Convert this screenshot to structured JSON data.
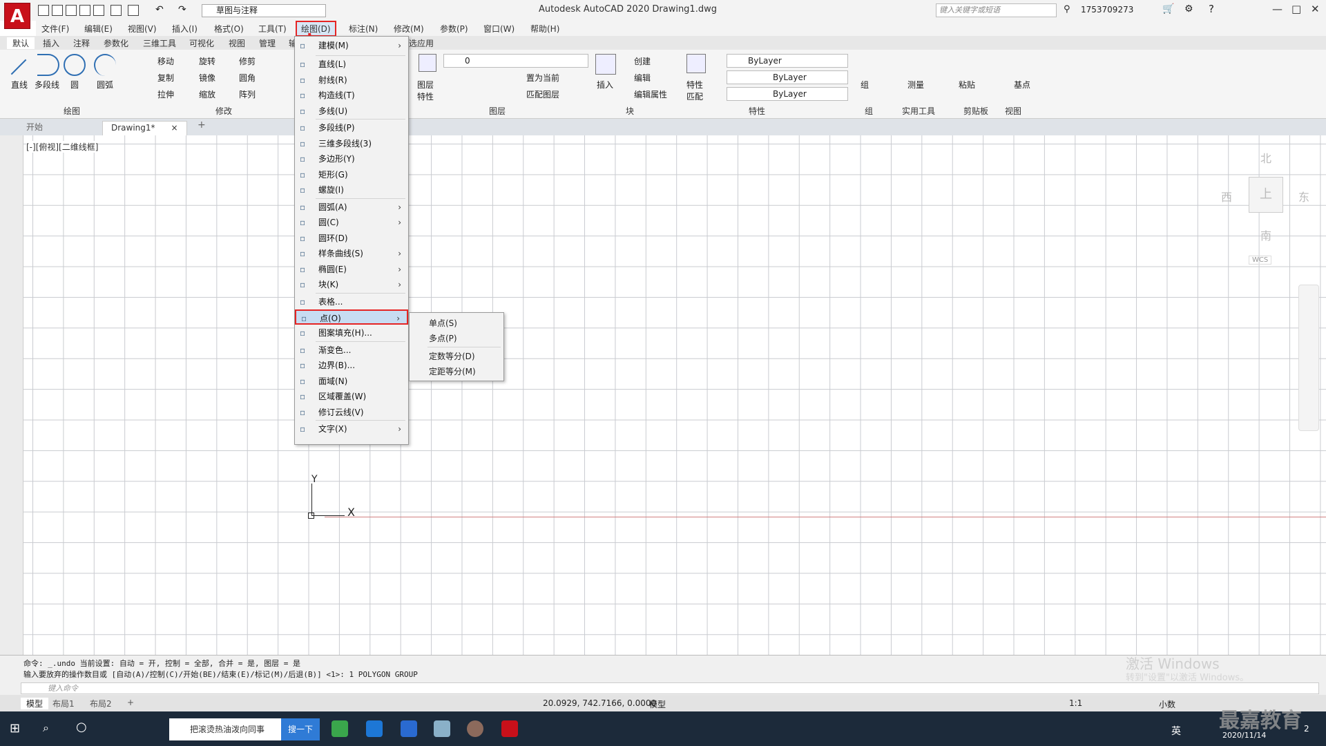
{
  "app": {
    "logo": "A",
    "workspace": "草图与注释",
    "window_title": "Autodesk AutoCAD 2020    Drawing1.dwg",
    "search_placeholder": "键入关键字或短语",
    "user": "1753709273"
  },
  "menubar": [
    "文件(F)",
    "编辑(E)",
    "视图(V)",
    "插入(I)",
    "格式(O)",
    "工具(T)",
    "绘图(D)",
    "标注(N)",
    "修改(M)",
    "参数(P)",
    "窗口(W)",
    "帮助(H)"
  ],
  "ribbon_tabs": [
    "默认",
    "插入",
    "注释",
    "参数化",
    "三维工具",
    "可视化",
    "视图",
    "管理",
    "输",
    "选应用"
  ],
  "ribbon": {
    "draw": {
      "title": "绘图",
      "items": [
        "直线",
        "多段线",
        "圆",
        "圆弧"
      ]
    },
    "modify": {
      "title": "修改",
      "items": [
        "移动",
        "旋转",
        "修剪",
        "复制",
        "镜像",
        "圆角",
        "拉伸",
        "缩放",
        "阵列"
      ]
    },
    "layers": {
      "title": "图层",
      "big": "图层特性",
      "layer_value": "0",
      "items": [
        "置为当前",
        "匹配图层"
      ]
    },
    "block": {
      "title": "块",
      "insert": "插入",
      "items": [
        "创建",
        "编辑",
        "编辑属性"
      ]
    },
    "properties": {
      "title": "特性",
      "big": "特性匹配",
      "color": "ByLayer",
      "linetype": "ByLayer",
      "lineweight": "ByLayer"
    },
    "group": {
      "title": "组",
      "big": "组"
    },
    "utilities": {
      "title": "实用工具",
      "big": "测量"
    },
    "clipboard": {
      "title": "剪贴板",
      "big": "粘贴"
    },
    "view": {
      "title": "视图",
      "big": "基点"
    }
  },
  "doc_tabs": {
    "start": "开始",
    "active": "Drawing1*",
    "close": "×",
    "add": "+"
  },
  "viewport_label": "[-][俯视][二维线框]",
  "viewcube": {
    "north": "北",
    "south": "南",
    "west": "西",
    "east": "东",
    "face": "上",
    "wcs": "WCS"
  },
  "ucs": {
    "x": "X",
    "y": "Y"
  },
  "draw_menu": [
    {
      "label": "建模(M)",
      "arrow": true
    },
    {
      "label": "直线(L)"
    },
    {
      "label": "射线(R)"
    },
    {
      "label": "构造线(T)"
    },
    {
      "label": "多线(U)"
    },
    {
      "label": "多段线(P)"
    },
    {
      "label": "三维多段线(3)"
    },
    {
      "label": "多边形(Y)"
    },
    {
      "label": "矩形(G)"
    },
    {
      "label": "螺旋(I)"
    },
    {
      "label": "圆弧(A)",
      "arrow": true
    },
    {
      "label": "圆(C)",
      "arrow": true
    },
    {
      "label": "圆环(D)"
    },
    {
      "label": "样条曲线(S)",
      "arrow": true
    },
    {
      "label": "椭圆(E)",
      "arrow": true
    },
    {
      "label": "块(K)",
      "arrow": true
    },
    {
      "label": "表格..."
    },
    {
      "label": "点(O)",
      "arrow": true
    },
    {
      "label": "图案填充(H)..."
    },
    {
      "label": "渐变色..."
    },
    {
      "label": "边界(B)..."
    },
    {
      "label": "面域(N)"
    },
    {
      "label": "区域覆盖(W)"
    },
    {
      "label": "修订云线(V)"
    },
    {
      "label": "文字(X)",
      "arrow": true
    }
  ],
  "point_submenu": [
    "单点(S)",
    "多点(P)",
    "定数等分(D)",
    "定距等分(M)"
  ],
  "command": {
    "line1": "命令: _.undo 当前设置: 自动 = 开, 控制 = 全部, 合并 = 是, 图层 = 是",
    "line2": "输入要放弃的操作数目或 [自动(A)/控制(C)/开始(BE)/结束(E)/标记(M)/后退(B)] <1>: 1 POLYGON GROUP",
    "placeholder": "键入命令"
  },
  "activate": {
    "line1": "激活 Windows",
    "line2": "转到\"设置\"以激活 Windows。"
  },
  "layouts": [
    "模型",
    "布局1",
    "布局2",
    "+"
  ],
  "status": {
    "coords": "20.0929, 742.7166, 0.0000",
    "model": "模型",
    "scale": "1:1",
    "units": "小数"
  },
  "taskbar": {
    "browser_tab": "把滚烫热油泼向同事",
    "search_btn": "搜一下",
    "ime": "英",
    "date": "2020/11/14",
    "notif": "2"
  },
  "brand": "最嘉教育",
  "colors": {
    "highlight": "#e52424",
    "selected": "#c7dcf2",
    "app_red": "#c8101a"
  }
}
